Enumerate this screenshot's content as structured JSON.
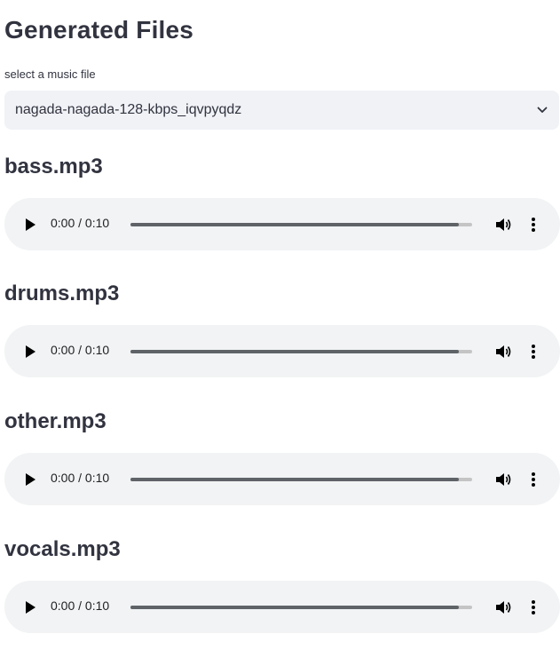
{
  "page": {
    "title": "Generated Files",
    "select_label": "select a music file",
    "selected_file": "nagada-nagada-128-kbps_iqvpyqdz"
  },
  "tracks": [
    {
      "name": "bass.mp3",
      "time": "0:00 / 0:10",
      "progress": 0.96
    },
    {
      "name": "drums.mp3",
      "time": "0:00 / 0:10",
      "progress": 0.96
    },
    {
      "name": "other.mp3",
      "time": "0:00 / 0:10",
      "progress": 0.96
    },
    {
      "name": "vocals.mp3",
      "time": "0:00 / 0:10",
      "progress": 0.96
    }
  ],
  "colors": {
    "text": "#31333f",
    "select_bg": "#f0f2f6",
    "player_bg": "#f1f3f4",
    "progress_track": "#c4c4c4",
    "progress_fill": "#5f6368"
  },
  "icons": {
    "dropdown": "chevron-down-icon",
    "play": "play-icon",
    "volume": "volume-icon",
    "more": "more-vertical-icon"
  }
}
